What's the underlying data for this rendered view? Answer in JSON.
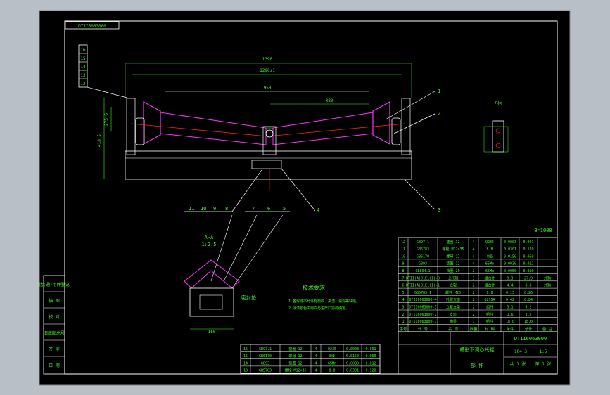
{
  "drawing": {
    "title_box": "DTII6063000",
    "bw_label": "B=1000",
    "overall_width": "1390",
    "inner_width": "1290±1",
    "roller_span": "950",
    "side_length": "380",
    "height_dim": "418.5",
    "left_height": "275.6",
    "view_label": "A向",
    "section_label": "A-A",
    "section_scale": "1:2.5",
    "gasket_label": "密封垫",
    "section_width": "160",
    "part_numbers_left": [
      "16",
      "15",
      "14",
      "13",
      "12"
    ],
    "balloon_bottom": [
      "11",
      "10",
      "9",
      "8",
      "7",
      "6",
      "5",
      "4",
      "3"
    ],
    "balloon_right": [
      "1",
      "2"
    ],
    "tech_title": "技术要求",
    "tech_notes": [
      "1.各焊缝不允许有裂纹、夹渣、漏焊等缺陷。",
      "2.涂漆颜色由用户与生产厂协商确定。"
    ]
  },
  "side_labels": [
    "借(通)用件登记",
    "描 图",
    "校 对",
    "旧底图总号",
    "签 字",
    "日 期"
  ],
  "bom_upper": {
    "rows": [
      {
        "no": "12",
        "code": "GB97.1",
        "name": "垫圈 12",
        "qty": "4",
        "mat": "Q235",
        "w1": "0.0003",
        "w2": "0.001",
        "note": ""
      },
      {
        "no": "11",
        "code": "GB5783",
        "name": "螺栓 M12×35",
        "qty": "4",
        "mat": "8.8",
        "w1": "0.0301",
        "w2": "0.120",
        "note": ""
      },
      {
        "no": "10",
        "code": "GB6170",
        "name": "螺母 12",
        "qty": "4",
        "mat": "8级",
        "w1": "0.0150",
        "w2": "0.060",
        "note": ""
      },
      {
        "no": "9",
        "code": "GB93",
        "name": "垫圈 12",
        "qty": "4",
        "mat": "65Mn",
        "w1": "0.0030",
        "w2": "0.012",
        "note": ""
      },
      {
        "no": "8",
        "code": "GB894.1",
        "name": "挡圈 20",
        "qty": "2",
        "mat": "65Mn",
        "w1": "0.0050",
        "w2": "0.010",
        "note": ""
      },
      {
        "no": "7",
        "code": "DTII(A)01E1(1)-0",
        "name": "上托辊",
        "qty": "3",
        "mat": "组合件",
        "w1": "9.3",
        "w2": "27.9",
        "note": "外购"
      },
      {
        "no": "6",
        "code": "DTII(A)01E1(1)-1",
        "name": "立辊",
        "qty": "2",
        "mat": "组合件",
        "w1": "4.4",
        "w2": "8.8",
        "note": "外购"
      },
      {
        "no": "5",
        "code": "GB5783.1",
        "name": "螺栓 M20",
        "qty": "2",
        "mat": "8.8",
        "w1": "0.13",
        "w2": "0.26",
        "note": ""
      },
      {
        "no": "4",
        "code": "DTII6063000-4",
        "name": "托辊支座",
        "qty": "2",
        "mat": "Q235A",
        "w1": "0.42",
        "w2": "0.84",
        "note": ""
      },
      {
        "no": "3",
        "code": "DTII6063000-3",
        "name": "立辊支架",
        "qty": "2",
        "mat": "组件",
        "w1": "3.1",
        "w2": "6.2",
        "note": ""
      },
      {
        "no": "2",
        "code": "DTII6063000-2",
        "name": "支座",
        "qty": "2",
        "mat": "组件",
        "w1": "1.6",
        "w2": "3.2",
        "note": ""
      },
      {
        "no": "1",
        "code": "DTII6063000-1",
        "name": "横梁",
        "qty": "1",
        "mat": "组件",
        "w1": "18.0",
        "w2": "18.0",
        "note": ""
      }
    ],
    "header": [
      "序号",
      "代 号",
      "名 称",
      "数量",
      "材 料",
      "单件",
      "总计",
      "备 注"
    ]
  },
  "bom_lower": {
    "rows": [
      {
        "no": "16",
        "code": "GB97.1",
        "name": "垫圈 12",
        "qty": "4",
        "mat": "Q235",
        "w1": "0.0003",
        "w2": "0.001"
      },
      {
        "no": "15",
        "code": "GB6170",
        "name": "螺母 12",
        "qty": "4",
        "mat": "8级",
        "w1": "0.0150",
        "w2": "0.060"
      },
      {
        "no": "14",
        "code": "GB93",
        "name": "垫圈 12",
        "qty": "4",
        "mat": "65Mn",
        "w1": "0.0030",
        "w2": "0.012"
      },
      {
        "no": "13",
        "code": "GB5783",
        "name": "螺栓 M12×35",
        "qty": "4",
        "mat": "8.8",
        "w1": "0.0301",
        "w2": "0.120"
      }
    ]
  },
  "title_block": {
    "drawing_no": "DTII6063000",
    "name": "槽形下调心托辊",
    "type": "部 件",
    "mass": "104.3",
    "scale": "1:5",
    "sheets": "共 1 张",
    "sheet": "第 1 张"
  },
  "colors": {
    "background": "#b9bfc7",
    "paper": "#000000",
    "line": "#ffffff",
    "text": "#39ff14",
    "roller": "#ff33ff",
    "axis": "#ff2222"
  }
}
